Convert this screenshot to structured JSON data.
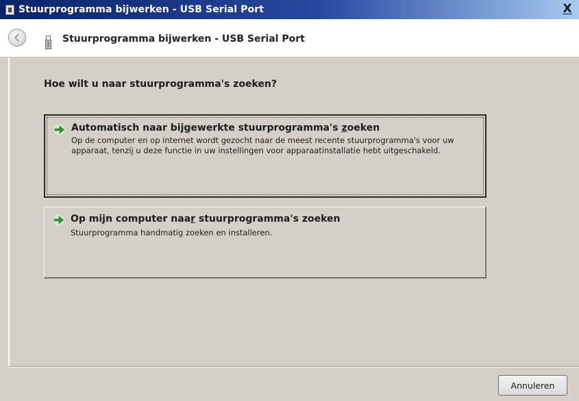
{
  "window": {
    "title": "Stuurprogramma bijwerken - USB Serial Port",
    "close_label": "X"
  },
  "header": {
    "title": "Stuurprogramma bijwerken - USB Serial Port",
    "back_icon": "back-arrow-icon",
    "device_icon": "usb-device-icon"
  },
  "main": {
    "question": "Hoe wilt u naar stuurprogramma's zoeken?",
    "options": [
      {
        "title_before": "Automatisch naar bijgewerkte stuurprogramma's ",
        "title_accel": "z",
        "title_after": "oeken",
        "description": "Op de computer en op internet wordt gezocht naar de meest recente stuurprogramma's voor uw apparaat, tenzij u deze functie in uw instellingen voor apparaatinstallatie hebt uitgeschakeld.",
        "icon": "green-arrow-icon",
        "focused": true
      },
      {
        "title_before": "Op mijn computer naa",
        "title_accel": "r",
        "title_after": " stuurprogramma's zoeken",
        "description": "Stuurprogramma handmatig zoeken en installeren.",
        "icon": "green-arrow-icon",
        "focused": false
      }
    ]
  },
  "footer": {
    "cancel_label": "Annuleren"
  },
  "colors": {
    "titlebar_start": "#0a246a",
    "titlebar_end": "#a6caf0",
    "dialog_background": "#d4d0c8",
    "arrow_green": "#2e9a2e"
  }
}
